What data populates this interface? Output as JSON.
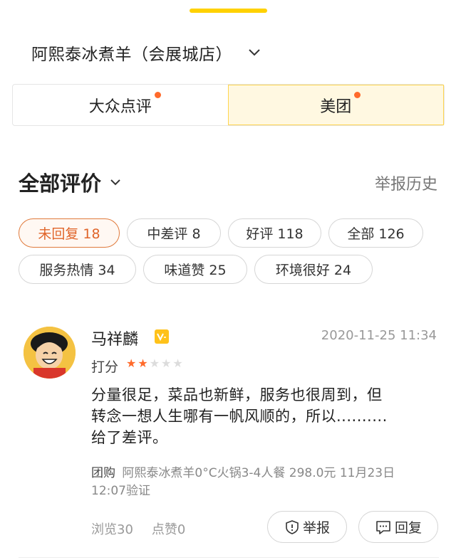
{
  "store": {
    "name": "阿熙泰冰煮羊（会展城店）"
  },
  "platform_tabs": [
    {
      "label": "大众点评",
      "has_dot": true,
      "active": false
    },
    {
      "label": "美团",
      "has_dot": true,
      "active": true
    }
  ],
  "reviews_section": {
    "title": "全部评价",
    "history_link": "举报历史"
  },
  "filter_chips": [
    {
      "label": "未回复 18",
      "active": true
    },
    {
      "label": "中差评 8",
      "active": false
    },
    {
      "label": "好评 118",
      "active": false
    },
    {
      "label": "全部 126",
      "active": false
    },
    {
      "label": "服务热情 34",
      "active": false
    },
    {
      "label": "味道赞 25",
      "active": false
    },
    {
      "label": "环境很好 24",
      "active": false
    }
  ],
  "review": {
    "user_name": "马祥麟",
    "time": "2020-11-25 11:34",
    "score_label": "打分",
    "rating": 2,
    "rating_max": 5,
    "body_lines": [
      "分量很足，菜品也新鲜，服务也很周到，但",
      "转念一想人生哪有一帆风顺的，所以..........",
      "给了差评。"
    ],
    "deal_tag": "团购",
    "deal_text": "阿熙泰冰煮羊0°C火锅3-4人餐 298.0元  11月23日 12:07验证",
    "views": "浏览30",
    "likes": "点赞0",
    "report_label": "举报",
    "reply_label": "回复"
  },
  "colors": {
    "accent": "#ffd100",
    "orange": "#ff6a2b",
    "tab_active_bg": "#fff8e1"
  }
}
